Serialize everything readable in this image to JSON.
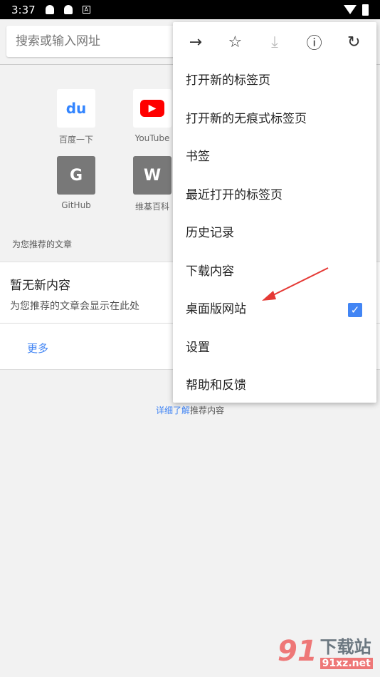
{
  "status": {
    "time": "3:37"
  },
  "search": {
    "placeholder": "搜索或输入网址"
  },
  "tiles": [
    {
      "label": "百度一下",
      "letter": "du",
      "color": "#3385ff"
    },
    {
      "label": "YouTube",
      "letter": "▶",
      "color": "#ff0000"
    },
    {
      "label": "GitHub",
      "letter": "G",
      "color": "#787878"
    },
    {
      "label": "维基百科",
      "letter": "W",
      "color": "#787878"
    }
  ],
  "articles": {
    "section": "为您推荐的文章",
    "title": "暂无新内容",
    "subtitle": "为您推荐的文章会显示在此处",
    "more": "更多",
    "learn_link": "详细了解",
    "learn_rest": "推荐内容"
  },
  "menu": {
    "items": [
      "打开新的标签页",
      "打开新的无痕式标签页",
      "书签",
      "最近打开的标签页",
      "历史记录",
      "下载内容",
      "桌面版网站",
      "设置",
      "帮助和反馈"
    ],
    "desktop_checked": true
  },
  "watermark": {
    "text": "下载站",
    "domain": "91xz.net"
  },
  "accent": "#4285f4"
}
